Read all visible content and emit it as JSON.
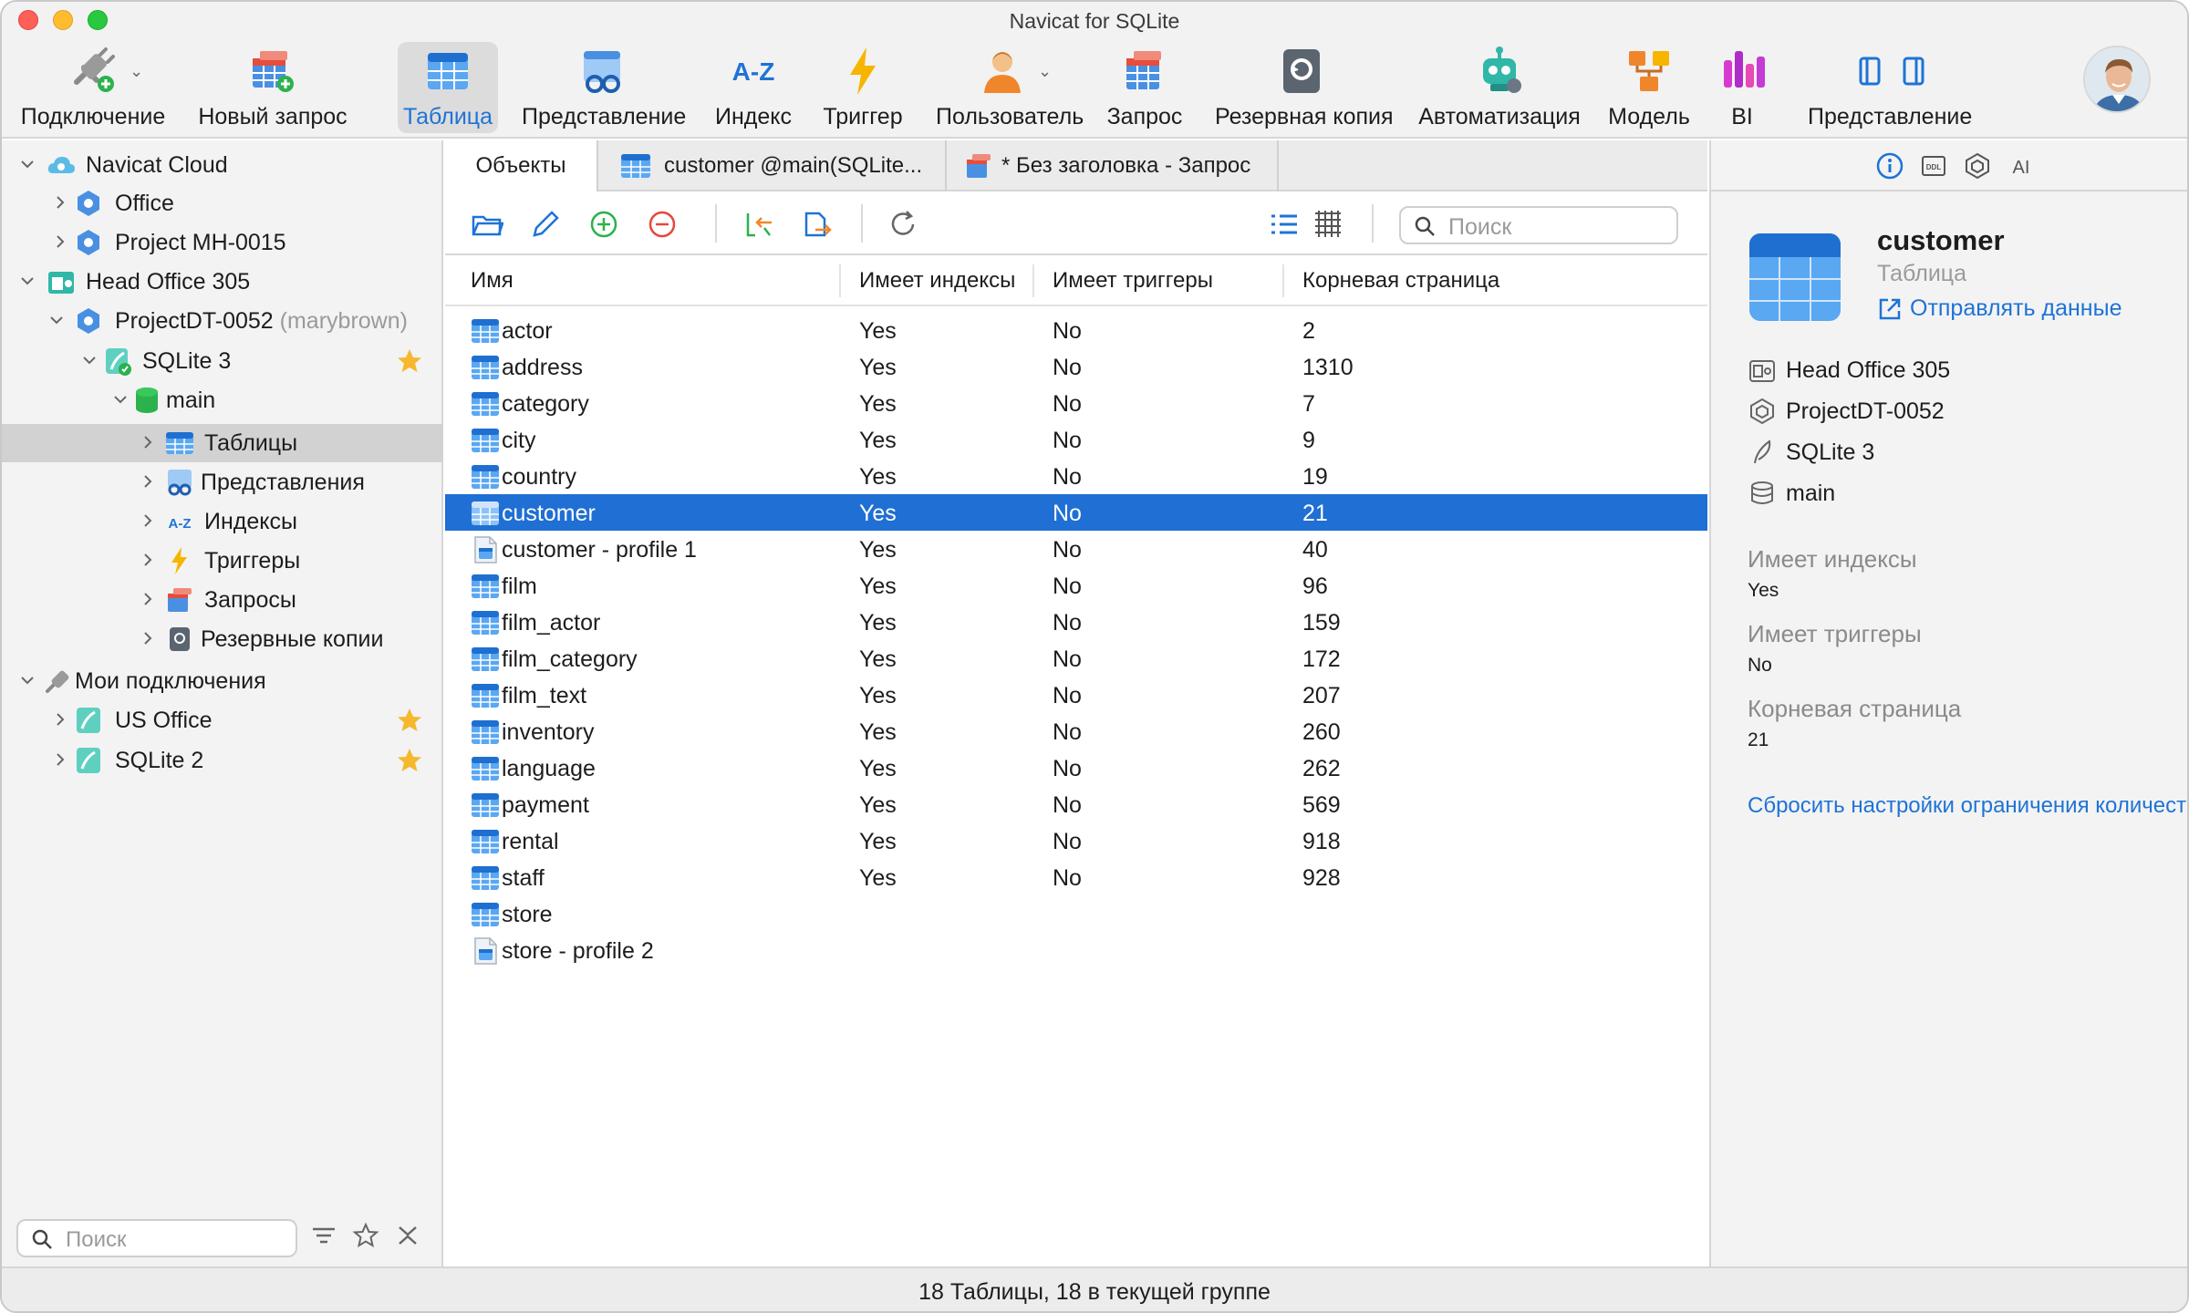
{
  "window": {
    "title": "Navicat for SQLite"
  },
  "toolbar": {
    "items": [
      {
        "label": "Подключение"
      },
      {
        "label": "Новый запрос"
      },
      {
        "label": "Таблица"
      },
      {
        "label": "Представление"
      },
      {
        "label": "Индекс"
      },
      {
        "label": "Триггер"
      },
      {
        "label": "Пользователь"
      },
      {
        "label": "Запрос"
      },
      {
        "label": "Резервная копия"
      },
      {
        "label": "Автоматизация"
      },
      {
        "label": "Модель"
      },
      {
        "label": "BI"
      },
      {
        "label": "Представление"
      }
    ],
    "index_icon_text": "A-Z"
  },
  "sidebar": {
    "tree": [
      {
        "label": "Navicat Cloud"
      },
      {
        "label": "Office"
      },
      {
        "label": "Project MH-0015"
      },
      {
        "label": "Head Office 305"
      },
      {
        "label": "ProjectDT-0052",
        "suffix": "(marybrown)"
      },
      {
        "label": "SQLite 3"
      },
      {
        "label": "main"
      },
      {
        "label": "Таблицы"
      },
      {
        "label": "Представления"
      },
      {
        "label": "Индексы"
      },
      {
        "label": "Триггеры"
      },
      {
        "label": "Запросы"
      },
      {
        "label": "Резервные копии"
      },
      {
        "label": "Мои подключения"
      },
      {
        "label": "US Office"
      },
      {
        "label": "SQLite 2"
      }
    ],
    "index_icon_text": "A-Z",
    "search_placeholder": "Поиск"
  },
  "tabs": [
    {
      "label": "Объекты"
    },
    {
      "label": "customer @main(SQLite..."
    },
    {
      "label": "* Без заголовка - Запрос"
    }
  ],
  "objects": {
    "search_placeholder": "Поиск",
    "columns": [
      "Имя",
      "Имеет индексы",
      "Имеет триггеры",
      "Корневая страница"
    ],
    "rows": [
      {
        "name": "actor",
        "idx": "Yes",
        "trg": "No",
        "root": "2",
        "kind": "table"
      },
      {
        "name": "address",
        "idx": "Yes",
        "trg": "No",
        "root": "1310",
        "kind": "table"
      },
      {
        "name": "category",
        "idx": "Yes",
        "trg": "No",
        "root": "7",
        "kind": "table"
      },
      {
        "name": "city",
        "idx": "Yes",
        "trg": "No",
        "root": "9",
        "kind": "table"
      },
      {
        "name": "country",
        "idx": "Yes",
        "trg": "No",
        "root": "19",
        "kind": "table"
      },
      {
        "name": "customer",
        "idx": "Yes",
        "trg": "No",
        "root": "21",
        "kind": "table"
      },
      {
        "name": "customer - profile 1",
        "idx": "Yes",
        "trg": "No",
        "root": "40",
        "kind": "profile"
      },
      {
        "name": "film",
        "idx": "Yes",
        "trg": "No",
        "root": "96",
        "kind": "table"
      },
      {
        "name": "film_actor",
        "idx": "Yes",
        "trg": "No",
        "root": "159",
        "kind": "table"
      },
      {
        "name": "film_category",
        "idx": "Yes",
        "trg": "No",
        "root": "172",
        "kind": "table"
      },
      {
        "name": "film_text",
        "idx": "Yes",
        "trg": "No",
        "root": "207",
        "kind": "table"
      },
      {
        "name": "inventory",
        "idx": "Yes",
        "trg": "No",
        "root": "260",
        "kind": "table"
      },
      {
        "name": "language",
        "idx": "Yes",
        "trg": "No",
        "root": "262",
        "kind": "table"
      },
      {
        "name": "payment",
        "idx": "Yes",
        "trg": "No",
        "root": "569",
        "kind": "table"
      },
      {
        "name": "rental",
        "idx": "Yes",
        "trg": "No",
        "root": "918",
        "kind": "table"
      },
      {
        "name": "staff",
        "idx": "Yes",
        "trg": "No",
        "root": "928",
        "kind": "table"
      },
      {
        "name": "store",
        "idx": "",
        "trg": "",
        "root": "",
        "kind": "table"
      },
      {
        "name": "store - profile 2",
        "idx": "",
        "trg": "",
        "root": "",
        "kind": "profile"
      }
    ],
    "selected_name": "customer"
  },
  "info_panel": {
    "ddl_icon_text": "DDL",
    "ai_icon_text": "AI",
    "name": "customer",
    "type": "Таблица",
    "send_link": "Отправлять данные",
    "path": [
      {
        "label": "Head Office 305"
      },
      {
        "label": "ProjectDT-0052"
      },
      {
        "label": "SQLite 3"
      },
      {
        "label": "main"
      }
    ],
    "properties": [
      {
        "label": "Имеет индексы",
        "value": "Yes"
      },
      {
        "label": "Имеет триггеры",
        "value": "No"
      },
      {
        "label": "Корневая страница",
        "value": "21"
      }
    ],
    "reset_link": "Сбросить настройки ограничения количества"
  },
  "status": {
    "text": "18 Таблицы, 18 в текущей группе"
  },
  "colors": {
    "selection": "#1f6fd4",
    "accent": "#1e73d6",
    "star": "#f5b82e"
  }
}
